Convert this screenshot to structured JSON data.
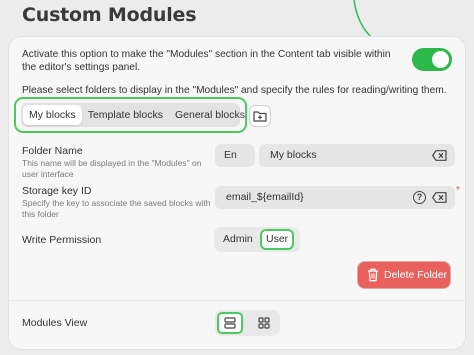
{
  "page": {
    "title": "Custom Modules"
  },
  "intro": {
    "text": "Activate this option to make the \"Modules\" section in the Content tab visible within the editor's settings panel."
  },
  "toggle": {
    "state": "on",
    "color": "#2db84b"
  },
  "folders": {
    "instruction": "Please select folders to display in the \"Modules\" and specify the rules for reading/writing them.",
    "tabs": [
      {
        "label": "My blocks",
        "active": true
      },
      {
        "label": "Template blocks",
        "active": false
      },
      {
        "label": "General blocks",
        "active": false
      }
    ],
    "add_icon": "folder-plus-icon"
  },
  "folder_name": {
    "label": "Folder Name",
    "help": "This name will be displayed in the \"Modules\" on user interface",
    "language": "En",
    "value": "My blocks"
  },
  "storage_key": {
    "label": "Storage key ID",
    "help": "Specify the key to associate the saved blocks with this folder",
    "value": "email_${emailId}",
    "help_glyph": "?",
    "required_mark": "*"
  },
  "write_permission": {
    "label": "Write Permission",
    "options": [
      "Admin",
      "User"
    ],
    "selected": "User"
  },
  "delete_button": {
    "label": "Delete Folder",
    "color": "#e9605d"
  },
  "modules_view": {
    "label": "Modules View",
    "options": [
      "list-view-icon",
      "grid-view-icon"
    ],
    "selected": "list-view-icon"
  },
  "accent_color": "#4cc95f"
}
